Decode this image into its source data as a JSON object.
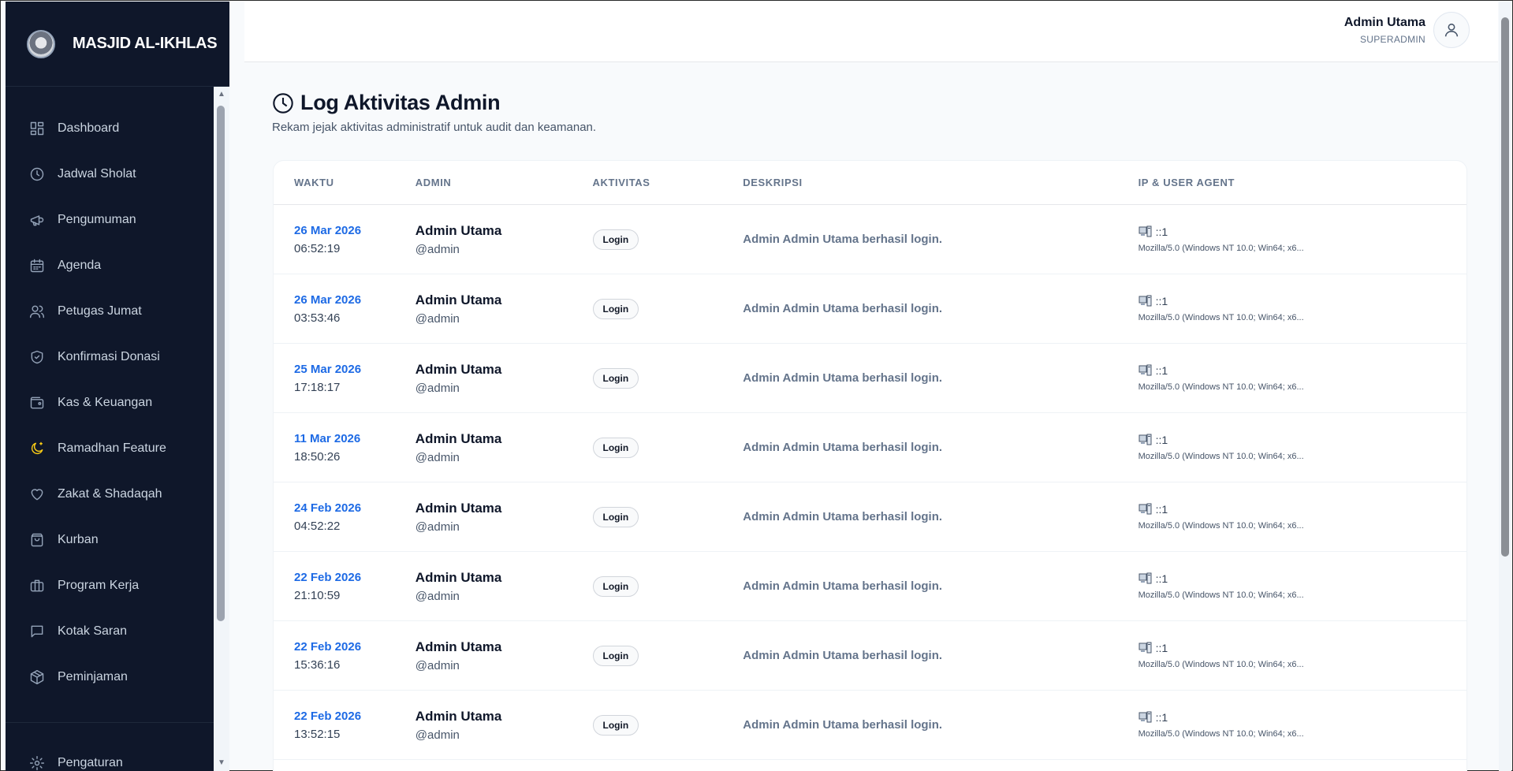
{
  "brand": {
    "title": "MASJID AL-IKHLAS"
  },
  "sidebar": {
    "items": [
      {
        "label": "Dashboard",
        "icon": "grid-icon"
      },
      {
        "label": "Jadwal Sholat",
        "icon": "clock-icon"
      },
      {
        "label": "Pengumuman",
        "icon": "megaphone-icon"
      },
      {
        "label": "Agenda",
        "icon": "calendar-icon"
      },
      {
        "label": "Petugas Jumat",
        "icon": "users-icon"
      },
      {
        "label": "Konfirmasi Donasi",
        "icon": "shield-check-icon"
      },
      {
        "label": "Kas & Keuangan",
        "icon": "wallet-icon"
      },
      {
        "label": "Ramadhan Feature",
        "icon": "moon-icon"
      },
      {
        "label": "Zakat & Shadaqah",
        "icon": "heart-icon"
      },
      {
        "label": "Kurban",
        "icon": "bag-icon"
      },
      {
        "label": "Program Kerja",
        "icon": "briefcase-icon"
      },
      {
        "label": "Kotak Saran",
        "icon": "message-icon"
      },
      {
        "label": "Peminjaman",
        "icon": "box-icon"
      }
    ],
    "bottom_items": [
      {
        "label": "Pengaturan",
        "icon": "gear-icon"
      }
    ]
  },
  "header": {
    "user_name": "Admin Utama",
    "user_role": "SUPERADMIN"
  },
  "page": {
    "title": "Log Aktivitas Admin",
    "subtitle": "Rekam jejak aktivitas administratif untuk audit dan keamanan."
  },
  "table": {
    "columns": [
      "WAKTU",
      "ADMIN",
      "AKTIVITAS",
      "DESKRIPSI",
      "IP & USER AGENT"
    ],
    "rows": [
      {
        "date": "26 Mar 2026",
        "time": "06:52:19",
        "admin": "Admin Utama",
        "handle": "@admin",
        "activity": "Login",
        "description": "Admin Admin Utama berhasil login.",
        "ip": "::1",
        "ua": "Mozilla/5.0 (Windows NT 10.0; Win64; x6..."
      },
      {
        "date": "26 Mar 2026",
        "time": "03:53:46",
        "admin": "Admin Utama",
        "handle": "@admin",
        "activity": "Login",
        "description": "Admin Admin Utama berhasil login.",
        "ip": "::1",
        "ua": "Mozilla/5.0 (Windows NT 10.0; Win64; x6..."
      },
      {
        "date": "25 Mar 2026",
        "time": "17:18:17",
        "admin": "Admin Utama",
        "handle": "@admin",
        "activity": "Login",
        "description": "Admin Admin Utama berhasil login.",
        "ip": "::1",
        "ua": "Mozilla/5.0 (Windows NT 10.0; Win64; x6..."
      },
      {
        "date": "11 Mar 2026",
        "time": "18:50:26",
        "admin": "Admin Utama",
        "handle": "@admin",
        "activity": "Login",
        "description": "Admin Admin Utama berhasil login.",
        "ip": "::1",
        "ua": "Mozilla/5.0 (Windows NT 10.0; Win64; x6..."
      },
      {
        "date": "24 Feb 2026",
        "time": "04:52:22",
        "admin": "Admin Utama",
        "handle": "@admin",
        "activity": "Login",
        "description": "Admin Admin Utama berhasil login.",
        "ip": "::1",
        "ua": "Mozilla/5.0 (Windows NT 10.0; Win64; x6..."
      },
      {
        "date": "22 Feb 2026",
        "time": "21:10:59",
        "admin": "Admin Utama",
        "handle": "@admin",
        "activity": "Login",
        "description": "Admin Admin Utama berhasil login.",
        "ip": "::1",
        "ua": "Mozilla/5.0 (Windows NT 10.0; Win64; x6..."
      },
      {
        "date": "22 Feb 2026",
        "time": "15:36:16",
        "admin": "Admin Utama",
        "handle": "@admin",
        "activity": "Login",
        "description": "Admin Admin Utama berhasil login.",
        "ip": "::1",
        "ua": "Mozilla/5.0 (Windows NT 10.0; Win64; x6..."
      },
      {
        "date": "22 Feb 2026",
        "time": "13:52:15",
        "admin": "Admin Utama",
        "handle": "@admin",
        "activity": "Login",
        "description": "Admin Admin Utama berhasil login.",
        "ip": "::1",
        "ua": "Mozilla/5.0 (Windows NT 10.0; Win64; x6..."
      }
    ]
  }
}
